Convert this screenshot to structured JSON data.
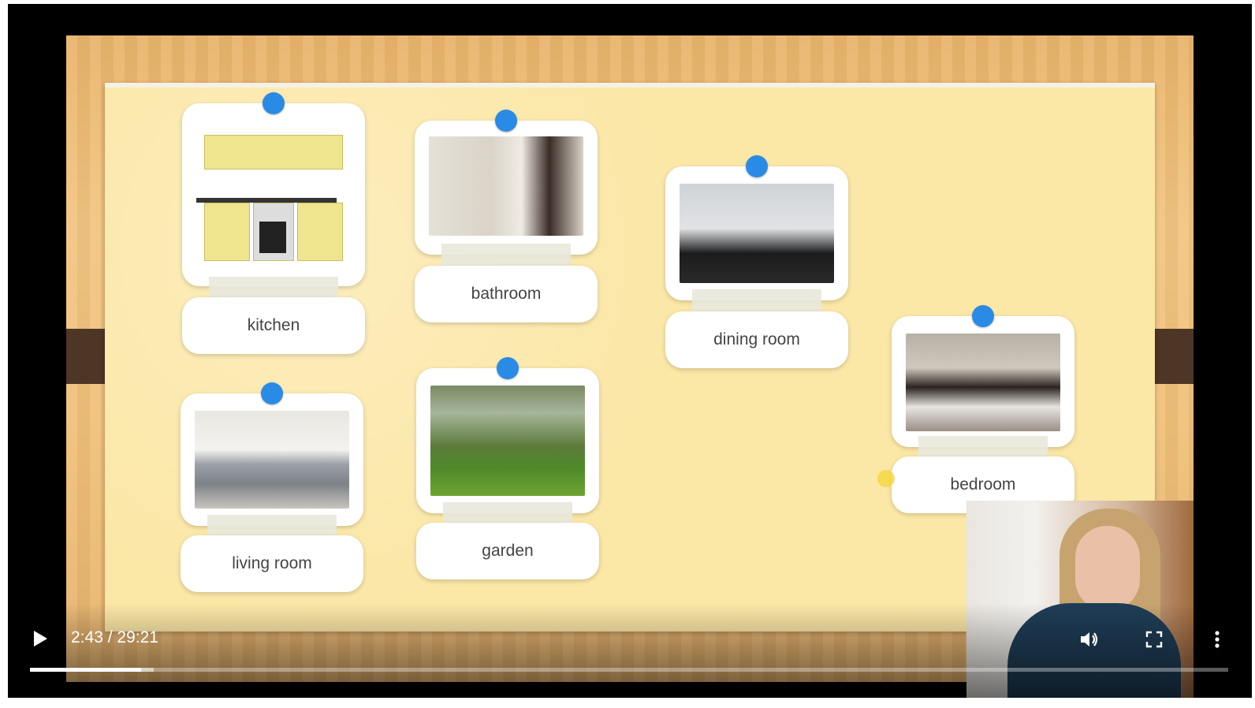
{
  "video": {
    "current_time": "2:43",
    "separator": "/",
    "duration": "29:21",
    "played_fraction": 0.093,
    "buffered_fraction": 0.103
  },
  "cards": [
    {
      "id": "kitchen",
      "label": "kitchen"
    },
    {
      "id": "bathroom",
      "label": "bathroom"
    },
    {
      "id": "dining",
      "label": "dining room"
    },
    {
      "id": "living",
      "label": "living room"
    },
    {
      "id": "garden",
      "label": "garden"
    },
    {
      "id": "bedroom",
      "label": "bedroom"
    }
  ],
  "colors": {
    "pin": "#2a8be6",
    "paper": "#fbe7a6",
    "wood": "#f0c07a"
  },
  "icons": {
    "play": "play-icon",
    "volume": "volume-icon",
    "fullscreen": "fullscreen-icon",
    "more": "more-vert-icon"
  }
}
